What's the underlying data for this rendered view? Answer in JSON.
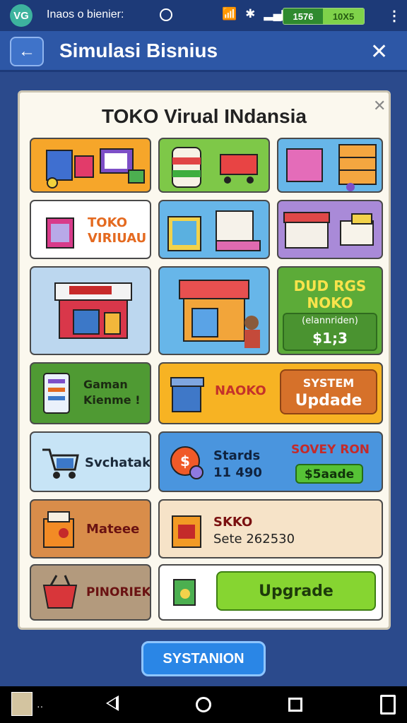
{
  "status_bar": {
    "app_badge": "VG",
    "notification": "Inaos o bienier:",
    "battery_left": "1576",
    "battery_right": "10X5",
    "menu_icon": "more-vert-icon"
  },
  "app_bar": {
    "title": "Simulasi Bisnius",
    "back_icon": "arrow-left-icon",
    "close_icon": "close-icon"
  },
  "panel": {
    "title": "TOKO Virual INdansia",
    "close_icon": "close-icon",
    "tiles": {
      "toko_virtual": {
        "line1": "TOKO",
        "line2": "VIRIUAU"
      },
      "dud_rgs": {
        "line1": "DUD RGS",
        "line2": "NOKO",
        "sub": "(elannriden)",
        "price": "$1;3"
      },
      "game_item": {
        "line1": "Gaman",
        "line2": "Kienme !"
      },
      "naoko": {
        "label": "NAOKO",
        "button_line1": "SYSTEM",
        "button_line2": "Updade"
      },
      "svchatak": {
        "label": "Svchatak"
      },
      "stards": {
        "line1": "Stards",
        "line2": "11 490",
        "badge": "SOVEY RON",
        "button": "$5aade"
      },
      "mateee": {
        "label": "Mateee"
      },
      "skko": {
        "line1": "SKKO",
        "line2": "Sete 262530"
      },
      "pinoriek": {
        "label": "PINORIEK"
      },
      "upgrade": {
        "button": "Upgrade"
      }
    }
  },
  "bottom_button": "SYSTANION",
  "nav": {
    "back_icon": "nav-back-icon",
    "home_icon": "nav-home-icon",
    "recents_icon": "nav-recents-icon"
  }
}
